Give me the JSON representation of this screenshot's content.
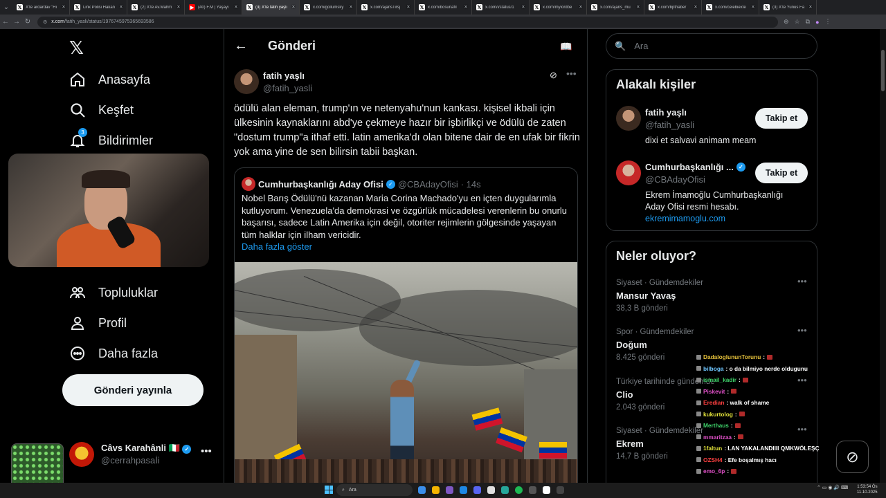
{
  "browser": {
    "tabs": [
      {
        "label": "X'te ardardav \"Hi",
        "fav": "x"
      },
      {
        "label": "Link Polisi Hakan",
        "fav": "x"
      },
      {
        "label": "(2) X'te Av.Mahm",
        "fav": "x"
      },
      {
        "label": "(40) F.M | Yaşayı",
        "fav": "yt"
      },
      {
        "label": "(3) X'te fatih yaşlı",
        "fav": "x",
        "active": true
      },
      {
        "label": "x.com/gollumsky",
        "fav": "x"
      },
      {
        "label": "x.com/ajansTirsj",
        "fav": "x"
      },
      {
        "label": "x.com/bosunafil",
        "fav": "x"
      },
      {
        "label": "x.com/i/status/1",
        "fav": "x"
      },
      {
        "label": "x.com/mylordbe",
        "fav": "x"
      },
      {
        "label": "x.com/ajans_mu",
        "fav": "x"
      },
      {
        "label": "x.com/bpthaber",
        "fav": "x"
      },
      {
        "label": "x.com/celebiexte",
        "fav": "x"
      },
      {
        "label": "(3) X'te Yunus Fa",
        "fav": "x"
      }
    ],
    "url_domain": "x.com",
    "url_path": "/fatih_yasli/status/1976745975365693586"
  },
  "nav": {
    "logo": "𝕏",
    "items": [
      {
        "label": "Anasayfa",
        "icon": "home-icon"
      },
      {
        "label": "Keşfet",
        "icon": "search-icon"
      },
      {
        "label": "Bildirimler",
        "icon": "bell-icon",
        "badge": "3"
      },
      {
        "label": "Topluluklar",
        "icon": "communities-icon"
      },
      {
        "label": "Profil",
        "icon": "profile-icon"
      },
      {
        "label": "Daha fazla",
        "icon": "more-circle-icon"
      }
    ],
    "post_button": "Gönderi yayınla",
    "account": {
      "name": "Câvs Karahânli 🇮🇹",
      "handle": "@cerrahpasaİi",
      "more": "•••"
    }
  },
  "main": {
    "title": "Gönderi",
    "author": {
      "name": "fatih yaşlı",
      "handle": "@fatih_yasli"
    },
    "text": "ödülü alan eleman, trump'ın ve netenyahu'nun kankası. kişisel ikbali için ülkesinin kaynaklarını abd'ye çekmeye hazır bir işbirlikçi ve ödülü de zaten \"dostum trump\"a ithaf etti. latin amerika'dı olan bitene dair de en ufak bir fikrin yok ama yine de sen bilirsin tabii başkan.",
    "quote": {
      "name": "Cumhurbaşkanlığı Aday Ofisi",
      "handle": "@CBAdayOfisi",
      "time": "· 14s",
      "text": "Nobel Barış Ödülü'nü kazanan Maria Corina Machado'yu en içten duygularımla kutluyorum. Venezuela'da demokrasi ve özgürlük mücadelesi verenlerin bu onurlu başarısı, sadece Latin Amerika için değil, otoriter rejimlerin gölgesinde yaşayan tüm halklar için ilham vericidir.",
      "more": "Daha fazla göster"
    }
  },
  "right": {
    "search_placeholder": "Ara",
    "related_title": "Alakalı kişiler",
    "people": [
      {
        "name": "fatih yaşlı",
        "handle": "@fatih_yasli",
        "bio": "dixi et salvavi animam meam",
        "link": "",
        "follow": "Takip et",
        "verified": false
      },
      {
        "name": "Cumhurbaşkanlığı ...",
        "handle": "@CBAdayOfisi",
        "bio": "Ekrem İmamoğlu Cumhurbaşkanlığı Aday Ofisi resmi hesabı.",
        "link": "ekremimamoglu.com",
        "follow": "Takip et",
        "verified": true
      }
    ],
    "trends_title": "Neler oluyor?",
    "trends": [
      {
        "context": "Siyaset · Gündemdekiler",
        "title": "Mansur Yavaş",
        "count": "38,3 B gönderi"
      },
      {
        "context": "Spor · Gündemdekiler",
        "title": "Doğum",
        "count": "8.425 gönderi"
      },
      {
        "context": "Türkiye tarihinde gündemde",
        "title": "Clio",
        "count": "2.043 gönderi"
      },
      {
        "context": "Siyaset · Gündemdekiler",
        "title": "Ekrem",
        "count": "14,7 B gönderi"
      }
    ]
  },
  "chat": [
    {
      "user": "DadaloglununTorunu",
      "msg": ":",
      "color": "#e5c13b",
      "emote": true
    },
    {
      "user": "bilboga",
      "msg": ": o da bilmiyo nerde oldugunu",
      "color": "#6ec6ff",
      "emote": false
    },
    {
      "user": "ismail_kadir",
      "msg": ":",
      "color": "#3fd46b",
      "emote": true
    },
    {
      "user": "Piskevit",
      "msg": ":",
      "color": "#e050c8",
      "emote": true
    },
    {
      "user": "Eredian",
      "msg": ": walk of shame",
      "color": "#ff4040",
      "emote": false
    },
    {
      "user": "kukurtolog",
      "msg": ":",
      "color": "#e5e53b",
      "emote": true
    },
    {
      "user": "Merthaus",
      "msg": ":",
      "color": "#3fd46b",
      "emote": true
    },
    {
      "user": "mmaritzaa",
      "msg": ":",
      "color": "#e050c8",
      "emote": true
    },
    {
      "user": "1faltun",
      "msg": ": LAN YAKALANDIIII QMKWÖLEŞÇ",
      "color": "#e5e53b",
      "emote": false
    },
    {
      "user": "OZSH4",
      "msg": ": Efe boşalmış hacı",
      "color": "#ff4040",
      "emote": false
    },
    {
      "user": "emo_6p",
      "msg": ":",
      "color": "#e050c8",
      "emote": true
    }
  ],
  "taskbar": {
    "search": "Ara",
    "time": "1:53:54 Ös",
    "date": "11.10.2025"
  }
}
